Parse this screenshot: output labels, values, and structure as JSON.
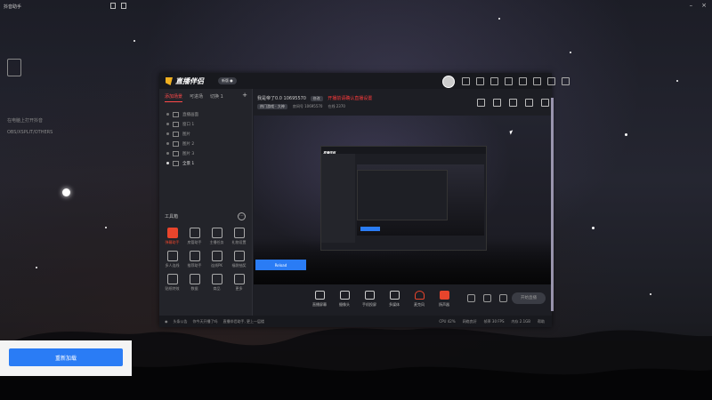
{
  "desktop": {
    "window_title": "抖音助手",
    "hint_lines": [
      "在电脑上打开抖音",
      "OBS/XSPLIT/OTHERS"
    ],
    "bottom_button": "重新加载"
  },
  "app": {
    "logo_text": "直播伴侣",
    "version_badge": "新版 ●",
    "sidebar": {
      "tabs": [
        "添加场景",
        "可进场",
        "切换 1"
      ],
      "plus": "+",
      "scenes": [
        "直播画面",
        "窗口 1",
        "图片",
        "图片 2",
        "图片 3",
        "全景 1"
      ],
      "tools_title": "工具箱",
      "tools": [
        {
          "label": "弹幕助手",
          "accent": true
        },
        {
          "label": "房管助手",
          "accent": false
        },
        {
          "label": "主播任务",
          "accent": false
        },
        {
          "label": "礼物设置",
          "accent": false
        },
        {
          "label": "多人连线",
          "accent": false
        },
        {
          "label": "推荐助手",
          "accent": false
        },
        {
          "label": "连线PK",
          "accent": false
        },
        {
          "label": "福袋抽奖",
          "accent": false
        },
        {
          "label": "贴纸特效",
          "accent": false
        },
        {
          "label": "数据",
          "accent": false
        },
        {
          "label": "商品",
          "accent": false
        },
        {
          "label": "更多",
          "accent": false
        }
      ]
    },
    "room_info": {
      "title": "我是帝了0.0 10695570",
      "pill": "修改",
      "live_status": "开播前请确认直播设置",
      "category_tag": "热门游戏 · 大神",
      "room_id_label": "房间号 10695570",
      "viewer_label": "在线 2370"
    },
    "preview_button": "Reload",
    "controls": [
      "直播屏幕",
      "摄像头",
      "手机投屏",
      "多媒体",
      "麦克风",
      "扬声器"
    ],
    "start_button": "开始直播",
    "status_bar": {
      "left": [
        "头条公告",
        "你今天开播了吗",
        "直播伴侣助手, 更上一层楼"
      ],
      "right": [
        "CPU 42%",
        "网络良好",
        "帧率 30 FPS",
        "内存 2.1GB",
        "帮助"
      ]
    }
  }
}
